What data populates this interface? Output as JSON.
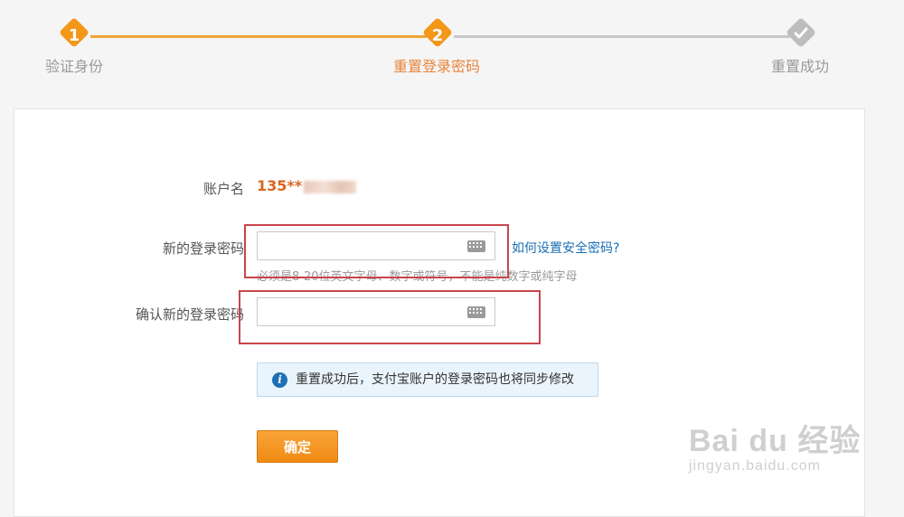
{
  "steps": [
    {
      "number": "1",
      "label": "验证身份"
    },
    {
      "number": "2",
      "label": "重置登录密码"
    },
    {
      "number": "",
      "label": "重置成功"
    }
  ],
  "form": {
    "account_label": "账户名",
    "account_value": "135**",
    "new_password_label": "新的登录密码",
    "new_password_value": "",
    "confirm_password_label": "确认新的登录密码",
    "confirm_password_value": "",
    "help_link": "如何设置安全密码?",
    "hint": "必须是8-20位英文字母、数字或符号，不能是纯数字或纯字母",
    "notice": "重置成功后，支付宝账户的登录密码也将同步修改",
    "confirm_button": "确定"
  },
  "watermark": {
    "main": "Bai du 经验",
    "sub": "jingyan.baidu.com"
  },
  "colors": {
    "accent": "#f29718",
    "link": "#1a6fb5",
    "highlight_box": "#c8454c"
  }
}
